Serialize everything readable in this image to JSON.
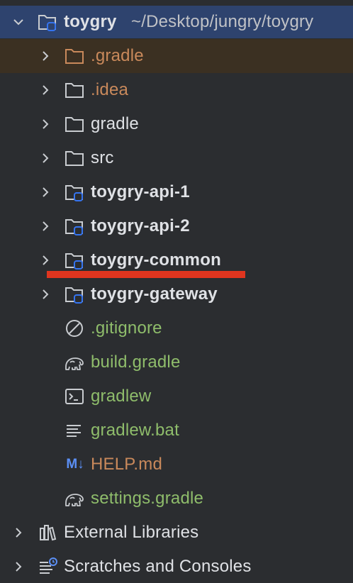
{
  "project_tree": {
    "root": {
      "name": "toygry",
      "path": "~/Desktop/jungry/toygry"
    },
    "items": [
      {
        "label": ".gradle",
        "type": "folder",
        "color": "#c9895b"
      },
      {
        "label": ".idea",
        "type": "folder",
        "color": "#c9895b"
      },
      {
        "label": "gradle",
        "type": "folder",
        "color": "#dfe1e5"
      },
      {
        "label": "src",
        "type": "folder",
        "color": "#dfe1e5"
      },
      {
        "label": "toygry-api-1",
        "type": "module",
        "color": "#dfe1e5"
      },
      {
        "label": "toygry-api-2",
        "type": "module",
        "color": "#dfe1e5"
      },
      {
        "label": "toygry-common",
        "type": "module",
        "color": "#dfe1e5"
      },
      {
        "label": "toygry-gateway",
        "type": "module",
        "color": "#dfe1e5"
      },
      {
        "label": ".gitignore",
        "type": "ignore-file",
        "color": "#8fbd6b"
      },
      {
        "label": "build.gradle",
        "type": "gradle-file",
        "color": "#8fbd6b"
      },
      {
        "label": "gradlew",
        "type": "shell-file",
        "color": "#8fbd6b"
      },
      {
        "label": "gradlew.bat",
        "type": "text-file",
        "color": "#8fbd6b"
      },
      {
        "label": "HELP.md",
        "type": "markdown-file",
        "color": "#c9895b"
      },
      {
        "label": "settings.gradle",
        "type": "gradle-file",
        "color": "#8fbd6b"
      }
    ],
    "external_libraries": "External Libraries",
    "scratches": "Scratches and Consoles"
  },
  "markdown_badge": "M↓",
  "colors": {
    "background": "#2b2d30",
    "root_selection": "#2e436e",
    "highlight_row": "#3b3022",
    "accent_blue": "#3574f0",
    "underline_red": "#e0351f"
  }
}
